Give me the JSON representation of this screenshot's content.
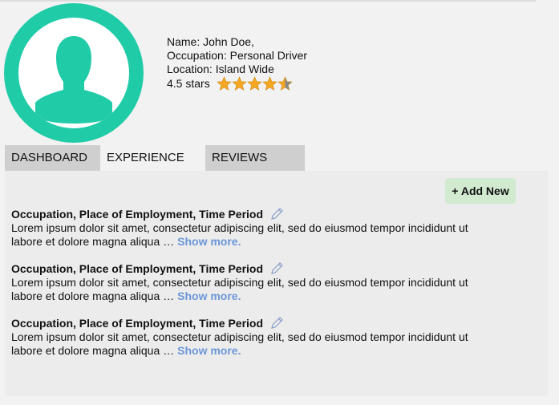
{
  "profile": {
    "name_line": "Name: John Doe,",
    "occupation_line": "Occupation: Personal Driver",
    "location_line": "Location: Island Wide",
    "rating_text": "4.5 stars",
    "rating_value": 4.5,
    "rating_max": 5,
    "avatar_icon": "user-silhouette-icon"
  },
  "tabs": [
    {
      "label": "DASHBOARD"
    },
    {
      "label": "EXPERIENCE"
    },
    {
      "label": "REVIEWS"
    }
  ],
  "panel": {
    "add_button_label": "+ Add New",
    "entries": [
      {
        "title": "Occupation, Place of Employment, Time Period",
        "line1": "Lorem ipsum dolor sit amet, consectetur adipiscing elit, sed do eiusmod tempor incididunt ut",
        "line2": "labore et dolore magna aliqua …",
        "show_more": "Show more."
      },
      {
        "title": "Occupation, Place of Employment, Time Period",
        "line1": "Lorem ipsum dolor sit amet, consectetur adipiscing elit, sed do eiusmod tempor incididunt ut",
        "line2": "labore et dolore magna aliqua …",
        "show_more": "Show more."
      },
      {
        "title": "Occupation, Place of Employment, Time Period",
        "line1": "Lorem ipsum dolor sit amet, consectetur adipiscing elit, sed do eiusmod tempor incididunt ut",
        "line2": "labore et dolore magna aliqua …",
        "show_more": "Show more."
      }
    ]
  },
  "colors": {
    "avatar_ring": "#20cba8",
    "star_fill": "#f5a623",
    "star_empty": "#888888",
    "link": "#6c96d8",
    "add_button_bg": "#d2ead0"
  }
}
